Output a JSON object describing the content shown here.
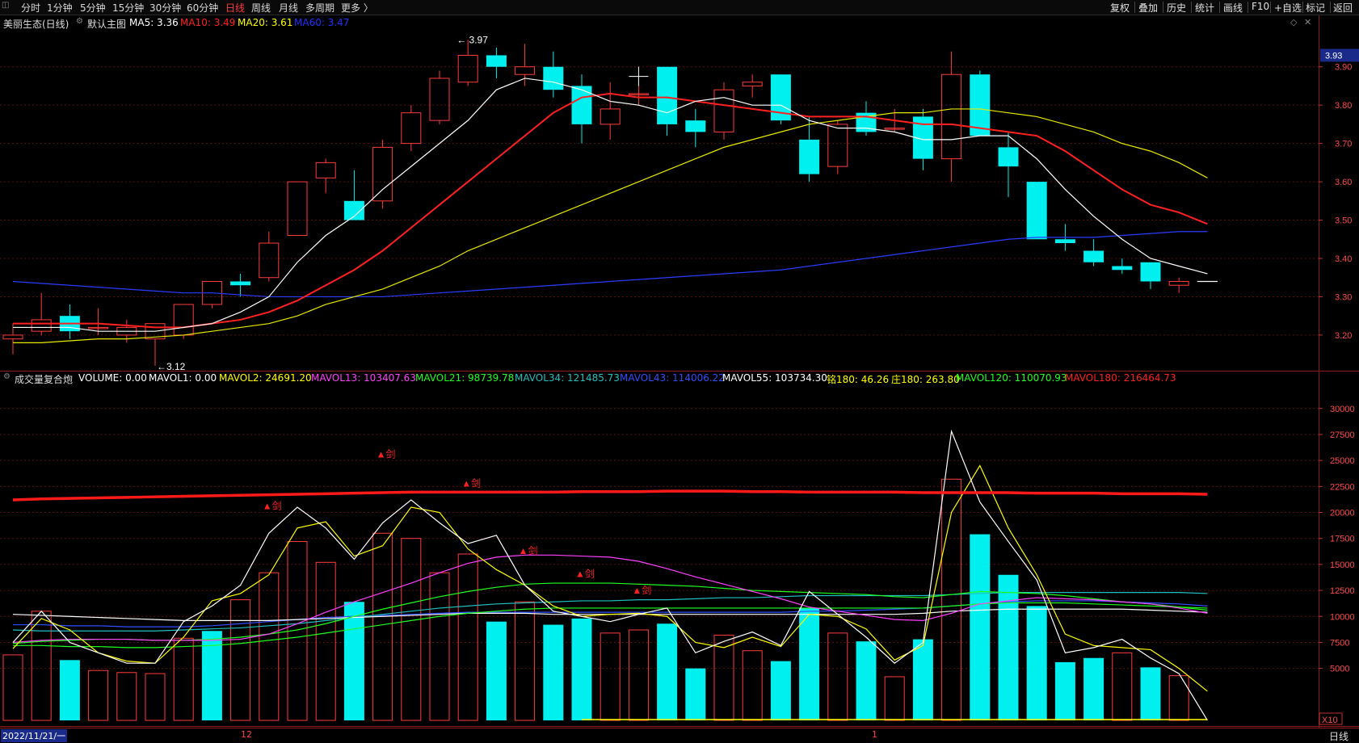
{
  "toolbar": {
    "periods": [
      "分时",
      "1分钟",
      "5分钟",
      "15分钟",
      "30分钟",
      "60分钟",
      "日线",
      "周线",
      "月线",
      "多周期",
      "更多 〉"
    ],
    "active_period": "日线",
    "right_buttons": [
      "复权",
      "叠加",
      "历史",
      "统计",
      "画线",
      "F10",
      "标记",
      "返回"
    ],
    "add_watch": "+自选"
  },
  "main_panel": {
    "title": "美丽生态(日线)",
    "indicator_name": "默认主图",
    "ma": [
      {
        "label": "MA5: 3.36",
        "color": "#ffffff"
      },
      {
        "label": "MA10: 3.49",
        "color": "#ff2020"
      },
      {
        "label": "MA20: 3.61",
        "color": "#ffff00"
      },
      {
        "label": "MA60: 3.47",
        "color": "#2030ff"
      }
    ],
    "price_ticks": [
      3.9,
      3.8,
      3.7,
      3.6,
      3.5,
      3.4,
      3.3,
      3.2
    ],
    "price_tick_labels": [
      "3.90",
      "3.80",
      "3.70",
      "3.60",
      "3.50",
      "3.40",
      "3.30",
      "3.20"
    ],
    "last_price": "3.93",
    "high_note": "3.97",
    "low_note": "3.12",
    "ylim": [
      3.105,
      3.99
    ]
  },
  "volume_panel": {
    "title": "成交量复合炮",
    "fields": [
      {
        "label": "VOLUME: 0.00",
        "color": "#ffffff"
      },
      {
        "label": "MAVOL1: 0.00",
        "color": "#ffffff"
      },
      {
        "label": "MAVOL2: 24691.20",
        "color": "#ffff00"
      },
      {
        "label": "MAVOL13: 103407.63",
        "color": "#ff40ff"
      },
      {
        "label": "MAVOL21: 98739.78",
        "color": "#20ff20"
      },
      {
        "label": "MAVOL34: 121485.73",
        "color": "#20c0c0"
      },
      {
        "label": "MAVOL43: 114006.22",
        "color": "#3050ff"
      },
      {
        "label": "MAVOL55: 103734.30",
        "color": "#ffffff"
      },
      {
        "label": "铭180: 46.26",
        "color": "#ffff00"
      },
      {
        "label": "庄180: 263.80",
        "color": "#ffff00"
      },
      {
        "label": "MAVOL120: 110070.93",
        "color": "#20ff20"
      },
      {
        "label": "MAVOL180: 216464.73",
        "color": "#ff2020"
      }
    ],
    "vol_ticks": [
      30000,
      27500,
      25000,
      22500,
      20000,
      17500,
      15000,
      12500,
      10000,
      7500,
      5000
    ],
    "vol_tick_labels": [
      "30000",
      "27500",
      "25000",
      "22500",
      "20000",
      "17500",
      "15000",
      "12500",
      "10000",
      "7500",
      "5000"
    ],
    "unit": "X10",
    "ylim": [
      0,
      32000
    ],
    "signal_label": "▲剑"
  },
  "bottom": {
    "date": "2022/11/21/一",
    "month_marks": [
      "12",
      "1"
    ],
    "period": "日线"
  },
  "chart_data": {
    "type": "candlestick",
    "candles": [
      {
        "o": 3.19,
        "h": 3.23,
        "l": 3.15,
        "c": 3.2
      },
      {
        "o": 3.21,
        "h": 3.31,
        "l": 3.2,
        "c": 3.24
      },
      {
        "o": 3.25,
        "h": 3.28,
        "l": 3.19,
        "c": 3.21
      },
      {
        "o": 3.22,
        "h": 3.27,
        "l": 3.2,
        "c": 3.22
      },
      {
        "o": 3.2,
        "h": 3.24,
        "l": 3.18,
        "c": 3.22
      },
      {
        "o": 3.19,
        "h": 3.23,
        "l": 3.12,
        "c": 3.23
      },
      {
        "o": 3.2,
        "h": 3.28,
        "l": 3.19,
        "c": 3.28
      },
      {
        "o": 3.28,
        "h": 3.34,
        "l": 3.27,
        "c": 3.34
      },
      {
        "o": 3.34,
        "h": 3.36,
        "l": 3.3,
        "c": 3.33
      },
      {
        "o": 3.35,
        "h": 3.47,
        "l": 3.34,
        "c": 3.44
      },
      {
        "o": 3.46,
        "h": 3.6,
        "l": 3.46,
        "c": 3.6
      },
      {
        "o": 3.61,
        "h": 3.66,
        "l": 3.57,
        "c": 3.65
      },
      {
        "o": 3.55,
        "h": 3.63,
        "l": 3.52,
        "c": 3.5
      },
      {
        "o": 3.55,
        "h": 3.71,
        "l": 3.53,
        "c": 3.69
      },
      {
        "o": 3.7,
        "h": 3.8,
        "l": 3.68,
        "c": 3.78
      },
      {
        "o": 3.76,
        "h": 3.89,
        "l": 3.75,
        "c": 3.87
      },
      {
        "o": 3.86,
        "h": 3.97,
        "l": 3.85,
        "c": 3.93
      },
      {
        "o": 3.93,
        "h": 3.95,
        "l": 3.87,
        "c": 3.9
      },
      {
        "o": 3.88,
        "h": 3.96,
        "l": 3.85,
        "c": 3.9
      },
      {
        "o": 3.9,
        "h": 3.94,
        "l": 3.82,
        "c": 3.84
      },
      {
        "o": 3.85,
        "h": 3.88,
        "l": 3.7,
        "c": 3.75
      },
      {
        "o": 3.75,
        "h": 3.86,
        "l": 3.71,
        "c": 3.79
      },
      {
        "o": 3.83,
        "h": 3.85,
        "l": 3.8,
        "c": 3.83
      },
      {
        "o": 3.9,
        "h": 3.9,
        "l": 3.72,
        "c": 3.75
      },
      {
        "o": 3.76,
        "h": 3.79,
        "l": 3.69,
        "c": 3.73
      },
      {
        "o": 3.73,
        "h": 3.86,
        "l": 3.71,
        "c": 3.84
      },
      {
        "o": 3.85,
        "h": 3.88,
        "l": 3.82,
        "c": 3.86
      },
      {
        "o": 3.88,
        "h": 3.88,
        "l": 3.75,
        "c": 3.76
      },
      {
        "o": 3.71,
        "h": 3.77,
        "l": 3.6,
        "c": 3.62
      },
      {
        "o": 3.64,
        "h": 3.76,
        "l": 3.62,
        "c": 3.75
      },
      {
        "o": 3.78,
        "h": 3.81,
        "l": 3.72,
        "c": 3.73
      },
      {
        "o": 3.74,
        "h": 3.79,
        "l": 3.73,
        "c": 3.74
      },
      {
        "o": 3.77,
        "h": 3.79,
        "l": 3.63,
        "c": 3.66
      },
      {
        "o": 3.66,
        "h": 3.94,
        "l": 3.6,
        "c": 3.88
      },
      {
        "o": 3.88,
        "h": 3.89,
        "l": 3.72,
        "c": 3.72
      },
      {
        "o": 3.69,
        "h": 3.73,
        "l": 3.56,
        "c": 3.64
      },
      {
        "o": 3.6,
        "h": 3.6,
        "l": 3.45,
        "c": 3.45
      },
      {
        "o": 3.45,
        "h": 3.49,
        "l": 3.42,
        "c": 3.44
      },
      {
        "o": 3.42,
        "h": 3.45,
        "l": 3.38,
        "c": 3.39
      },
      {
        "o": 3.38,
        "h": 3.4,
        "l": 3.36,
        "c": 3.37
      },
      {
        "o": 3.39,
        "h": 3.39,
        "l": 3.32,
        "c": 3.34
      },
      {
        "o": 3.33,
        "h": 3.35,
        "l": 3.31,
        "c": 3.34
      },
      {
        "o": 3.34,
        "h": 3.34,
        "l": 3.34,
        "c": 3.34
      }
    ],
    "ma5": [
      3.22,
      3.22,
      3.22,
      3.21,
      3.21,
      3.21,
      3.22,
      3.23,
      3.26,
      3.3,
      3.39,
      3.46,
      3.51,
      3.58,
      3.64,
      3.7,
      3.76,
      3.84,
      3.87,
      3.86,
      3.84,
      3.81,
      3.8,
      3.78,
      3.81,
      3.82,
      3.8,
      3.8,
      3.76,
      3.74,
      3.74,
      3.73,
      3.71,
      3.71,
      3.72,
      3.72,
      3.66,
      3.58,
      3.51,
      3.45,
      3.4,
      3.38,
      3.36
    ],
    "ma10": [
      3.23,
      3.23,
      3.23,
      3.23,
      3.225,
      3.22,
      3.22,
      3.23,
      3.24,
      3.26,
      3.29,
      3.33,
      3.37,
      3.42,
      3.48,
      3.54,
      3.6,
      3.66,
      3.72,
      3.78,
      3.82,
      3.83,
      3.82,
      3.82,
      3.81,
      3.8,
      3.79,
      3.78,
      3.77,
      3.77,
      3.77,
      3.76,
      3.75,
      3.75,
      3.74,
      3.73,
      3.72,
      3.68,
      3.63,
      3.58,
      3.54,
      3.52,
      3.49
    ],
    "ma20": [
      3.18,
      3.18,
      3.185,
      3.19,
      3.19,
      3.195,
      3.2,
      3.21,
      3.22,
      3.23,
      3.25,
      3.28,
      3.3,
      3.32,
      3.35,
      3.38,
      3.42,
      3.45,
      3.48,
      3.51,
      3.54,
      3.57,
      3.6,
      3.63,
      3.66,
      3.69,
      3.71,
      3.73,
      3.75,
      3.76,
      3.77,
      3.78,
      3.78,
      3.79,
      3.79,
      3.78,
      3.77,
      3.75,
      3.73,
      3.7,
      3.68,
      3.65,
      3.61
    ],
    "ma60": [
      3.34,
      3.335,
      3.33,
      3.325,
      3.32,
      3.315,
      3.31,
      3.31,
      3.305,
      3.3,
      3.3,
      3.3,
      3.3,
      3.3,
      3.305,
      3.31,
      3.315,
      3.32,
      3.325,
      3.33,
      3.335,
      3.34,
      3.345,
      3.35,
      3.355,
      3.36,
      3.365,
      3.37,
      3.38,
      3.39,
      3.4,
      3.41,
      3.42,
      3.43,
      3.44,
      3.45,
      3.455,
      3.455,
      3.455,
      3.46,
      3.465,
      3.47,
      3.47
    ],
    "volumes": [
      {
        "v": 6300,
        "up": true
      },
      {
        "v": 10500,
        "up": true
      },
      {
        "v": 5800,
        "up": false
      },
      {
        "v": 4800,
        "up": true
      },
      {
        "v": 4600,
        "up": true
      },
      {
        "v": 4500,
        "up": true
      },
      {
        "v": 7900,
        "up": true
      },
      {
        "v": 8600,
        "up": false
      },
      {
        "v": 11600,
        "up": true
      },
      {
        "v": 14200,
        "up": true
      },
      {
        "v": 17200,
        "up": true
      },
      {
        "v": 15200,
        "up": true
      },
      {
        "v": 11400,
        "up": false
      },
      {
        "v": 18000,
        "up": true
      },
      {
        "v": 17500,
        "up": true
      },
      {
        "v": 14200,
        "up": true
      },
      {
        "v": 16000,
        "up": true
      },
      {
        "v": 9500,
        "up": false
      },
      {
        "v": 11400,
        "up": true
      },
      {
        "v": 9200,
        "up": false
      },
      {
        "v": 9800,
        "up": false
      },
      {
        "v": 8400,
        "up": true
      },
      {
        "v": 8700,
        "up": true
      },
      {
        "v": 9300,
        "up": false
      },
      {
        "v": 5000,
        "up": false
      },
      {
        "v": 8200,
        "up": true
      },
      {
        "v": 6700,
        "up": true
      },
      {
        "v": 5700,
        "up": false
      },
      {
        "v": 10800,
        "up": false
      },
      {
        "v": 8400,
        "up": true
      },
      {
        "v": 7600,
        "up": false
      },
      {
        "v": 4200,
        "up": true
      },
      {
        "v": 7800,
        "up": false
      },
      {
        "v": 23200,
        "up": true
      },
      {
        "v": 17900,
        "up": false
      },
      {
        "v": 14000,
        "up": false
      },
      {
        "v": 11000,
        "up": false
      },
      {
        "v": 5600,
        "up": false
      },
      {
        "v": 6000,
        "up": false
      },
      {
        "v": 6500,
        "up": true
      },
      {
        "v": 5100,
        "up": false
      },
      {
        "v": 4300,
        "up": true
      }
    ],
    "mavol_white": [
      7500,
      10500,
      7500,
      6500,
      5500,
      5500,
      9500,
      11000,
      13000,
      18000,
      20500,
      18500,
      15500,
      19000,
      21200,
      19000,
      17000,
      17800,
      13000,
      10500,
      10000,
      9500,
      10200,
      10800,
      6500,
      7600,
      8500,
      7200,
      12400,
      10200,
      8000,
      5500,
      7500,
      27800,
      21000,
      17200,
      13500,
      6500,
      7000,
      7800,
      6000,
      4500,
      0
    ],
    "mavol_yellow": [
      6900,
      9800,
      8700,
      6500,
      5700,
      5500,
      8000,
      11500,
      12200,
      14000,
      18500,
      19100,
      15800,
      16800,
      20500,
      20000,
      16500,
      14500,
      13000,
      11000,
      10000,
      10200,
      10300,
      10000,
      7500,
      7000,
      8000,
      7100,
      10200,
      10000,
      8800,
      5800,
      7200,
      20000,
      24500,
      18500,
      14000,
      8300,
      7200,
      7000,
      6800,
      5000,
      2800
    ],
    "mavol_magenta": [
      7500,
      7700,
      7800,
      7800,
      7800,
      7700,
      7700,
      7700,
      7800,
      8300,
      9300,
      10400,
      11400,
      12300,
      13200,
      14200,
      15100,
      15700,
      15900,
      15900,
      15800,
      15700,
      15300,
      14600,
      13800,
      13100,
      12400,
      11700,
      10900,
      10500,
      10100,
      9700,
      9600,
      10300,
      11200,
      11500,
      11800,
      11700,
      11600,
      11400,
      11200,
      10800,
      10300
    ],
    "mavol_green": [
      7400,
      7600,
      7700,
      7800,
      7800,
      7700,
      7700,
      7800,
      8000,
      8300,
      8700,
      9300,
      10000,
      10700,
      11300,
      11900,
      12400,
      12800,
      13100,
      13200,
      13200,
      13200,
      13100,
      13000,
      12900,
      12700,
      12500,
      12400,
      12300,
      12200,
      12100,
      11900,
      11800,
      12100,
      12400,
      12300,
      12200,
      12000,
      11700,
      11400,
      11200,
      10900,
      10600
    ],
    "mavol_cyan": [
      8700,
      8600,
      8600,
      8600,
      8600,
      8600,
      8700,
      8800,
      8900,
      9100,
      9300,
      9600,
      9900,
      10200,
      10500,
      10800,
      11000,
      11200,
      11300,
      11400,
      11500,
      11500,
      11600,
      11600,
      11700,
      11800,
      11800,
      11900,
      12000,
      12000,
      12000,
      12000,
      12000,
      12100,
      12200,
      12300,
      12300,
      12300,
      12300,
      12300,
      12300,
      12300,
      12200
    ],
    "mavol_blue": [
      9200,
      9200,
      9100,
      9100,
      9000,
      9000,
      9000,
      9100,
      9300,
      9500,
      9700,
      9900,
      10000,
      10100,
      10200,
      10300,
      10400,
      10400,
      10400,
      10400,
      10400,
      10400,
      10400,
      10400,
      10400,
      10400,
      10400,
      10400,
      10500,
      10500,
      10600,
      10700,
      10800,
      11000,
      11200,
      11400,
      11500,
      11500,
      11500,
      11400,
      11300,
      11200,
      11000
    ],
    "mavol_white_flat": [
      10200,
      10100,
      10000,
      9900,
      9800,
      9700,
      9600,
      9600,
      9600,
      9600,
      9700,
      9800,
      9900,
      10000,
      10100,
      10200,
      10300,
      10300,
      10300,
      10200,
      10200,
      10200,
      10200,
      10200,
      10200,
      10200,
      10200,
      10200,
      10200,
      10200,
      10200,
      10200,
      10300,
      10500,
      10600,
      10700,
      10700,
      10700,
      10700,
      10700,
      10600,
      10500,
      10400
    ],
    "mavol_green_low": [
      7200,
      7200,
      7100,
      7100,
      7000,
      7000,
      7100,
      7200,
      7400,
      7700,
      8000,
      8400,
      8800,
      9200,
      9600,
      10000,
      10300,
      10500,
      10700,
      10800,
      10800,
      10800,
      10800,
      10800,
      10800,
      10800,
      10800,
      10800,
      10800,
      10800,
      10800,
      10800,
      10800,
      11000,
      11200,
      11300,
      11300,
      11300,
      11200,
      11100,
      11000,
      10900,
      10800
    ],
    "mavol180_red": [
      21200,
      21300,
      21350,
      21400,
      21450,
      21500,
      21550,
      21600,
      21650,
      21700,
      21750,
      21800,
      21850,
      21900,
      21950,
      21950,
      21950,
      21950,
      21950,
      21950,
      22000,
      22000,
      22000,
      22050,
      22050,
      22050,
      22000,
      22000,
      21950,
      21950,
      21950,
      21950,
      21900,
      21900,
      21900,
      21900,
      21850,
      21850,
      21850,
      21800,
      21800,
      21800,
      21750
    ],
    "signals": [
      {
        "i": 9,
        "v": 20300
      },
      {
        "i": 13,
        "v": 25300
      },
      {
        "i": 16,
        "v": 22500
      },
      {
        "i": 18,
        "v": 16000
      },
      {
        "i": 20,
        "v": 13800
      },
      {
        "i": 22,
        "v": 12200
      }
    ]
  }
}
